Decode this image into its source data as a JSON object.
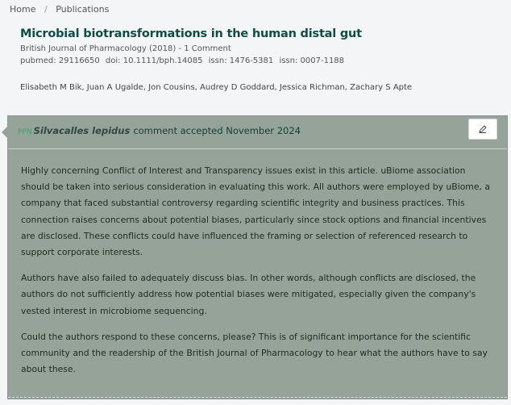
{
  "breadcrumb": {
    "items": [
      "Home",
      "Publications"
    ],
    "separator": "/"
  },
  "publication": {
    "title": "Microbial biotransformations in the human distal gut",
    "journal_line": "British Journal of Pharmacology (2018) - 1 Comment",
    "ids": {
      "pubmed": "pubmed: 29116650",
      "doi": "doi: 10.1111/bph.14085",
      "issn1": "issn: 1476-5381",
      "issn2": "issn: 0007-1188"
    },
    "authors": "Elisabeth M Bik, Juan A Ugalde, Jon Cousins, Audrey D Goddard, Jessica Richman, Zachary S Apte"
  },
  "comment": {
    "badge": "PPN",
    "user": "Silvacalles lepidus",
    "status": "comment accepted November 2024",
    "edit_icon": "pen-icon",
    "paragraphs": [
      "Highly concerning Conflict of Interest and Transparency issues exist in this article. uBiome association should be taken into serious consideration in evaluating this work. All authors were employed by uBiome, a company that faced substantial controversy regarding scientific integrity and business practices. This connection raises concerns about potential biases, particularly since stock options and financial incentives are disclosed. These conflicts could have influenced the framing or selection of referenced research to support corporate interests.",
      "Authors have also failed to adequately discuss bias. In other words, although conflicts are disclosed, the authors do not sufficiently address how potential biases were mitigated, especially given the company's vested interest in microbiome sequencing.",
      "Could the authors respond to these concerns, please? This is of significant importance for the scientific community and the readership of the British Journal of Pharmacology to hear what the authors have to say about these."
    ]
  },
  "colors": {
    "title": "#0d4f46",
    "card_background": "#96a398",
    "badge": "#3fa46b"
  }
}
